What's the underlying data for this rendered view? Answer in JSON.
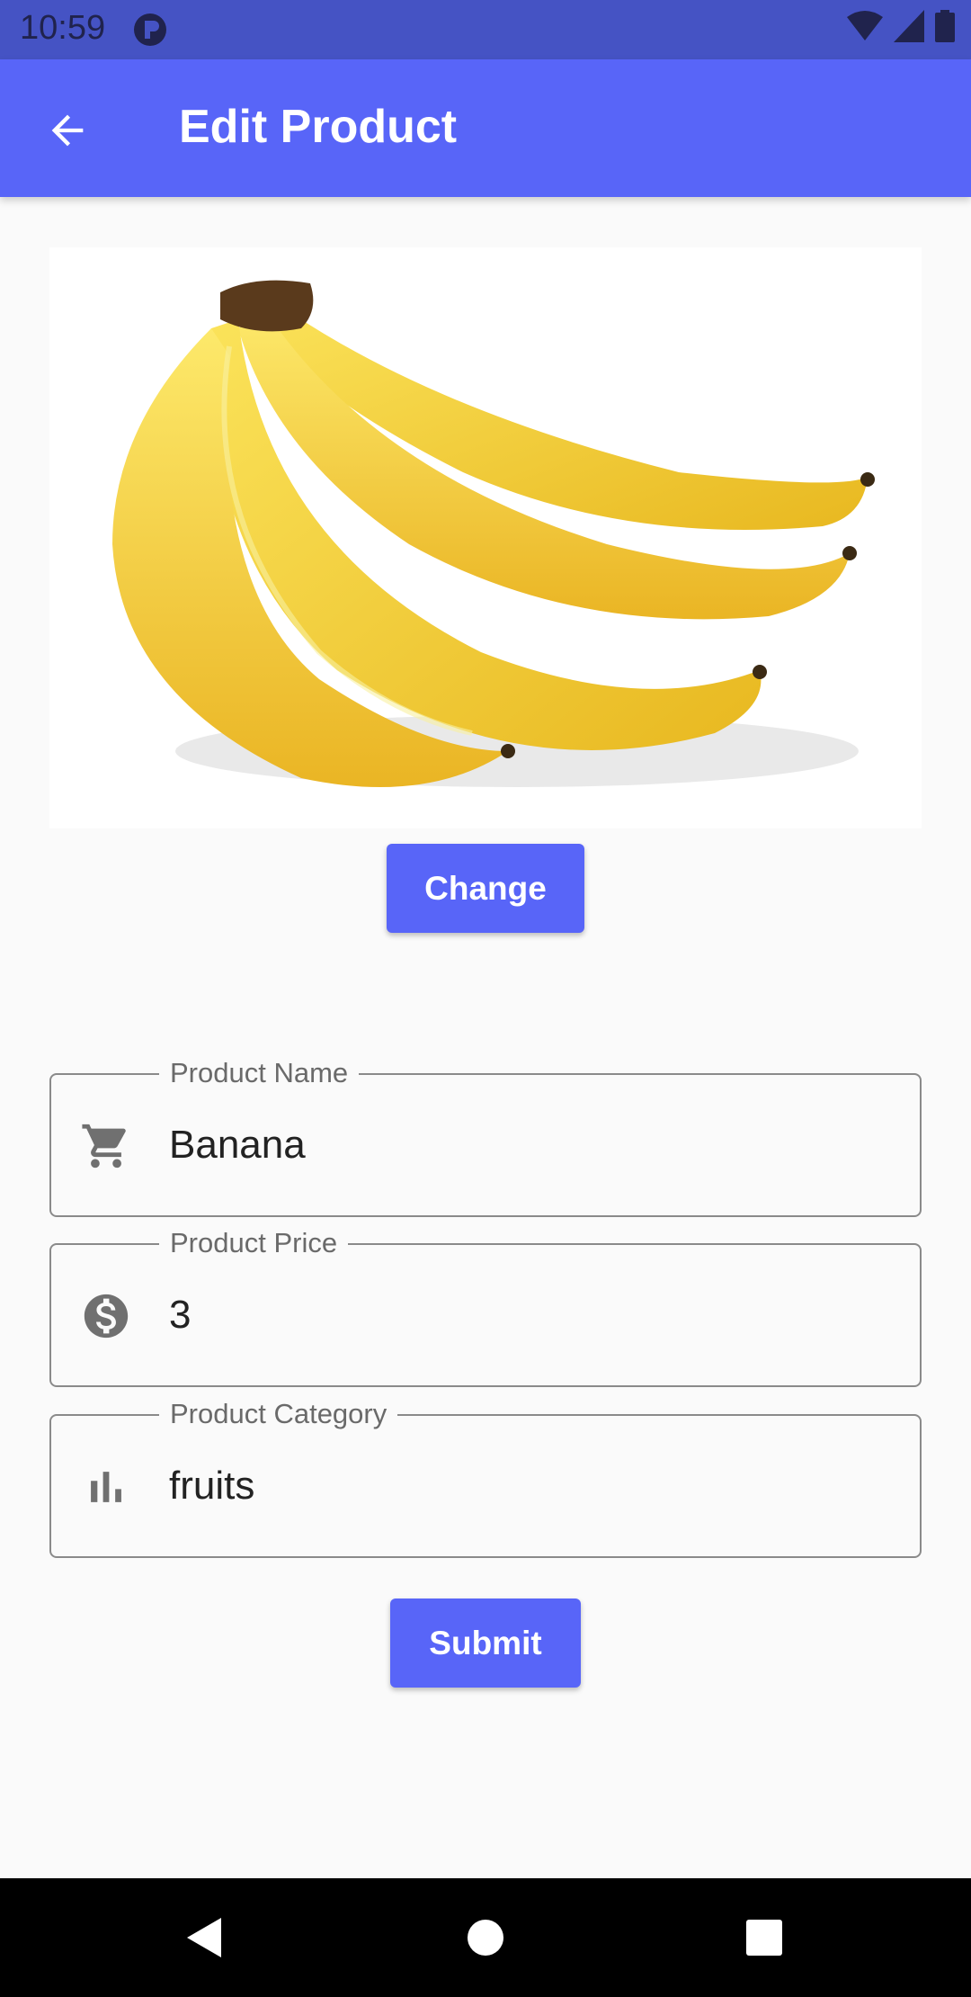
{
  "status_bar": {
    "time": "10:59"
  },
  "app_bar": {
    "title": "Edit Product"
  },
  "image": {
    "alt": "Banana"
  },
  "change_button": {
    "label": "Change"
  },
  "fields": [
    {
      "label": "Product Name",
      "value": "Banana",
      "icon": "cart-icon"
    },
    {
      "label": "Product Price",
      "value": "3",
      "icon": "dollar-icon"
    },
    {
      "label": "Product Category",
      "value": "fruits",
      "icon": "bar-chart-icon"
    }
  ],
  "submit_button": {
    "label": "Submit"
  },
  "colors": {
    "primary": "#5865f8",
    "status": "#4553c4"
  }
}
